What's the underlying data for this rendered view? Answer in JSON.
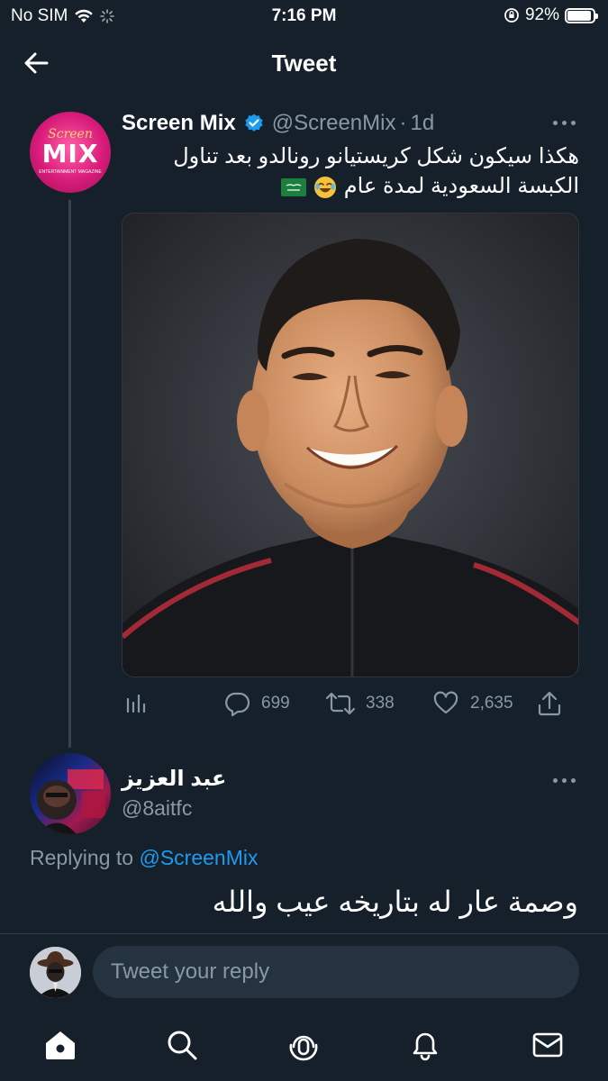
{
  "status_bar": {
    "carrier": "No SIM",
    "time": "7:16 PM",
    "battery": "92%",
    "battery_level": 0.92
  },
  "header": {
    "title": "Tweet"
  },
  "tweet": {
    "name": "Screen Mix",
    "handle": "@ScreenMix",
    "separator": "·",
    "time": "1d",
    "avatar_text": {
      "top": "Screen",
      "main": "MIX",
      "bottom": "ENTERTAINMENT MAGAZINE"
    },
    "text_line1": "هكذا سيكون شكل كريستيانو رونالدو بعد تناول",
    "text_line2": "الكبسة السعودية لمدة عام",
    "actions": {
      "replies": "699",
      "retweets": "338",
      "likes": "2,635"
    }
  },
  "reply": {
    "name": "عبد العزيز",
    "handle": "@8aitfc",
    "replying_prefix": "Replying to",
    "replying_to": "@ScreenMix",
    "text": "وصمة عار له بتاريخه عيب والله"
  },
  "composer": {
    "placeholder": "Tweet your reply"
  },
  "colors": {
    "background": "#15202b",
    "accent": "#1d9bf0",
    "muted": "#8899a6"
  }
}
